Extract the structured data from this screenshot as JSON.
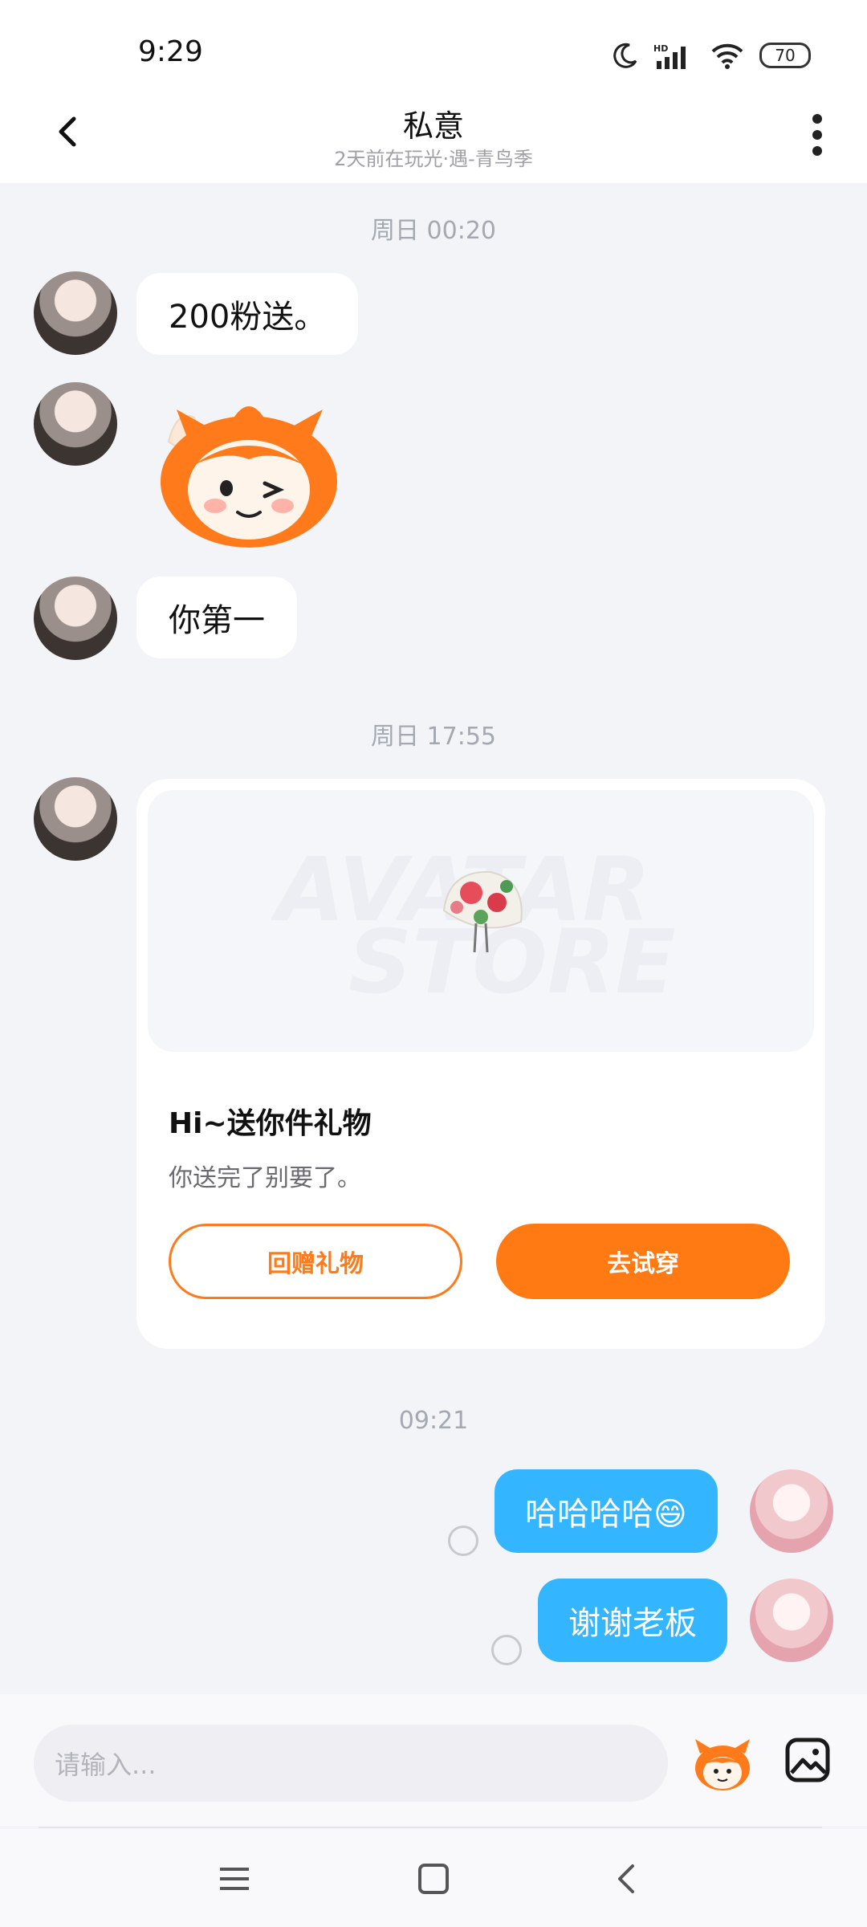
{
  "status_bar": {
    "time": "9:29",
    "battery": "70",
    "icons": [
      "moon-icon",
      "hd-signal-icon",
      "wifi-icon",
      "battery-icon"
    ]
  },
  "header": {
    "title": "私意",
    "subtitle": "2天前在玩光·遇-青鸟季",
    "back_icon": "chevron-left-icon",
    "more_icon": "more-vertical-icon"
  },
  "messages": {
    "ts1": "周日 00:20",
    "msg1": "200粉送。",
    "msg3": "你第一",
    "ts2": "周日 17:55",
    "gift": {
      "title": "Hi~送你件礼物",
      "desc": "你送完了别要了。",
      "return_gift": "回赠礼物",
      "try_on": "去试穿",
      "watermark1": "AVATAR",
      "watermark2": "STORE"
    },
    "ts3": "09:21",
    "msg_out1": "哈哈哈哈😄",
    "msg_out2": "谢谢老板"
  },
  "input_bar": {
    "placeholder": "请输入..."
  },
  "colors": {
    "accent_orange": "#ff7a12",
    "bubble_blue": "#33b6ff"
  }
}
